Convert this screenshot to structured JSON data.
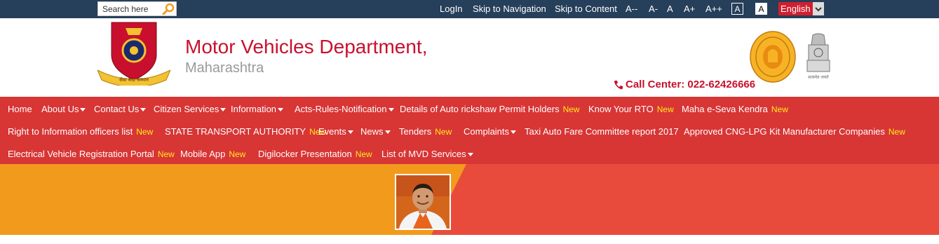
{
  "topbar": {
    "search_placeholder": "Search here",
    "links": {
      "login": "LogIn",
      "skip_nav": "Skip to Navigation",
      "skip_content": "Skip to Content",
      "font_smallest": "A--",
      "font_smaller": "A-",
      "font_normal": "A",
      "font_larger": "A+",
      "font_largest": "A++",
      "contrast_dark": "A",
      "contrast_light": "A"
    },
    "language": "English"
  },
  "header": {
    "title": "Motor Vehicles Department,",
    "subtitle": "Maharashtra",
    "call_center": "Call Center: 022-62426666",
    "logo_text": "सेवा सदा सम्मान",
    "emblem_caption": "सत्यमेव जयते"
  },
  "nav": {
    "new_label": "New",
    "items": [
      {
        "label": "Home"
      },
      {
        "label": "About Us"
      },
      {
        "label": "Contact Us"
      },
      {
        "label": "Citizen Services"
      },
      {
        "label": "Information"
      },
      {
        "label": "Acts-Rules-Notification"
      },
      {
        "label": "Details of Auto rickshaw Permit Holders"
      },
      {
        "label": "Know Your RTO"
      },
      {
        "label": "Maha e-Seva Kendra"
      },
      {
        "label": "Right to Information officers list"
      },
      {
        "label": "STATE TRANSPORT AUTHORITY"
      },
      {
        "label": "Events"
      },
      {
        "label": "News"
      },
      {
        "label": "Tenders"
      },
      {
        "label": "Complaints"
      },
      {
        "label": "Taxi Auto Fare Committee report 2017"
      },
      {
        "label": "Approved CNG-LPG Kit Manufacturer Companies"
      },
      {
        "label": "Electrical Vehicle Registration Portal"
      },
      {
        "label": "Mobile App"
      },
      {
        "label": "Digilocker Presentation"
      },
      {
        "label": "List of MVD Services"
      }
    ]
  },
  "colors": {
    "topbar": "#263f5a",
    "brand_red": "#c8102e",
    "nav_red": "#d83535",
    "new_badge": "#ffec1a",
    "banner_orange": "#f29a1c",
    "banner_red": "#e84b3c"
  }
}
